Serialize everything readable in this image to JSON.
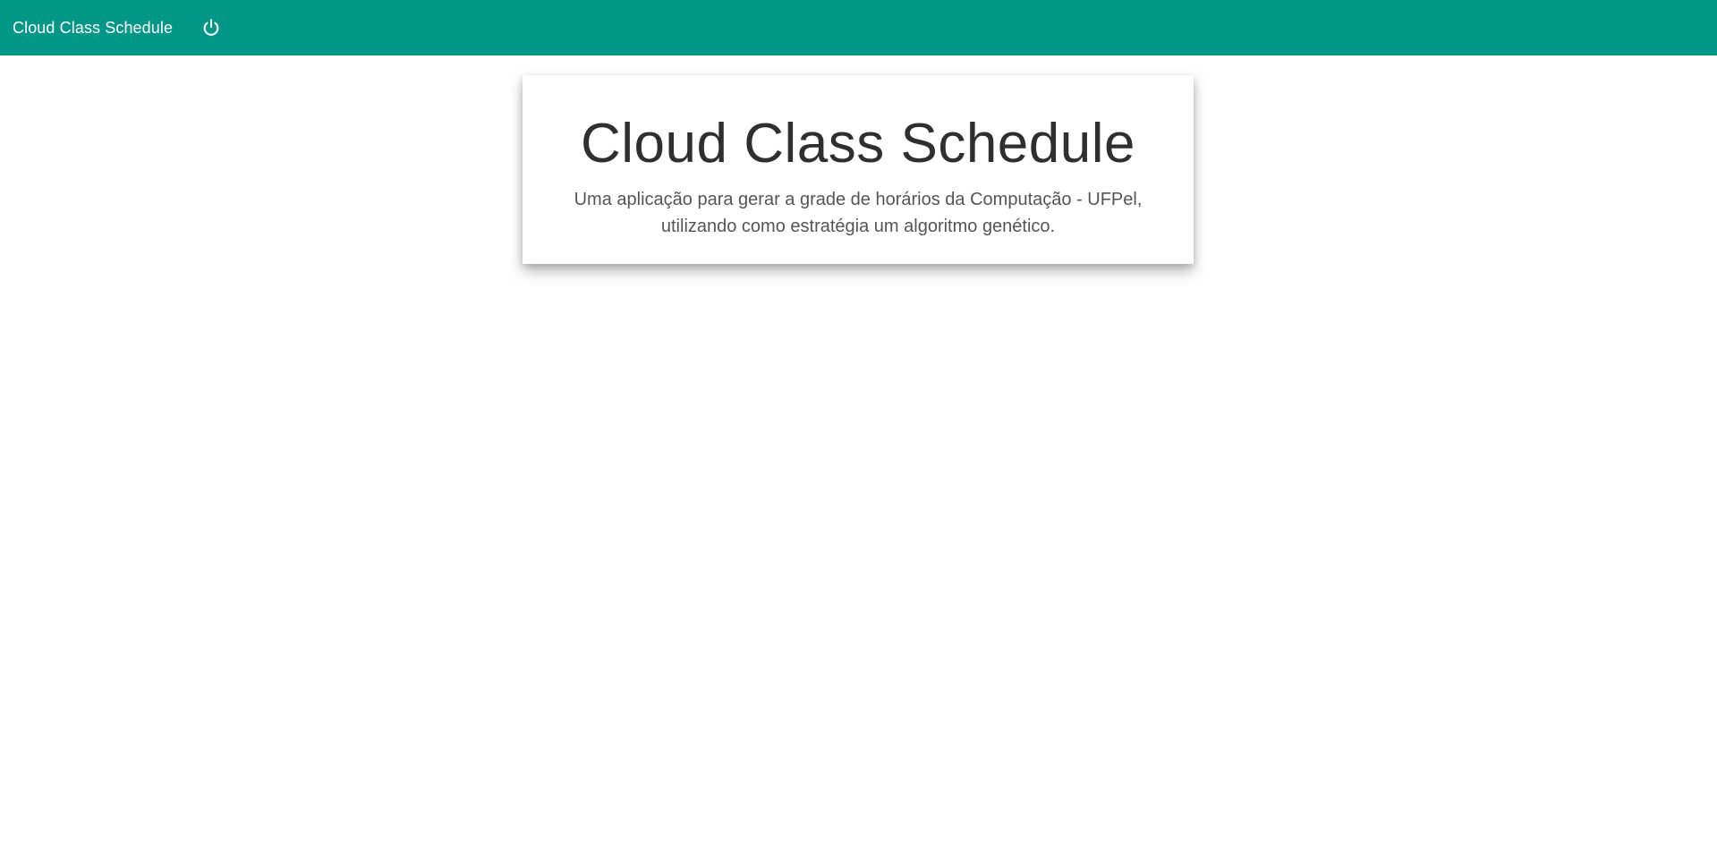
{
  "app": {
    "brand": "Cloud Class Schedule",
    "accent_color": "#009688"
  },
  "navbar": {
    "power_icon": "power-icon"
  },
  "hero": {
    "title": "Cloud Class Schedule",
    "subtitle_line1": "Uma aplicação para gerar a grade de horários da Computação - UFPel,",
    "subtitle_line2": "utilizando como estratégia um algoritmo genético."
  }
}
